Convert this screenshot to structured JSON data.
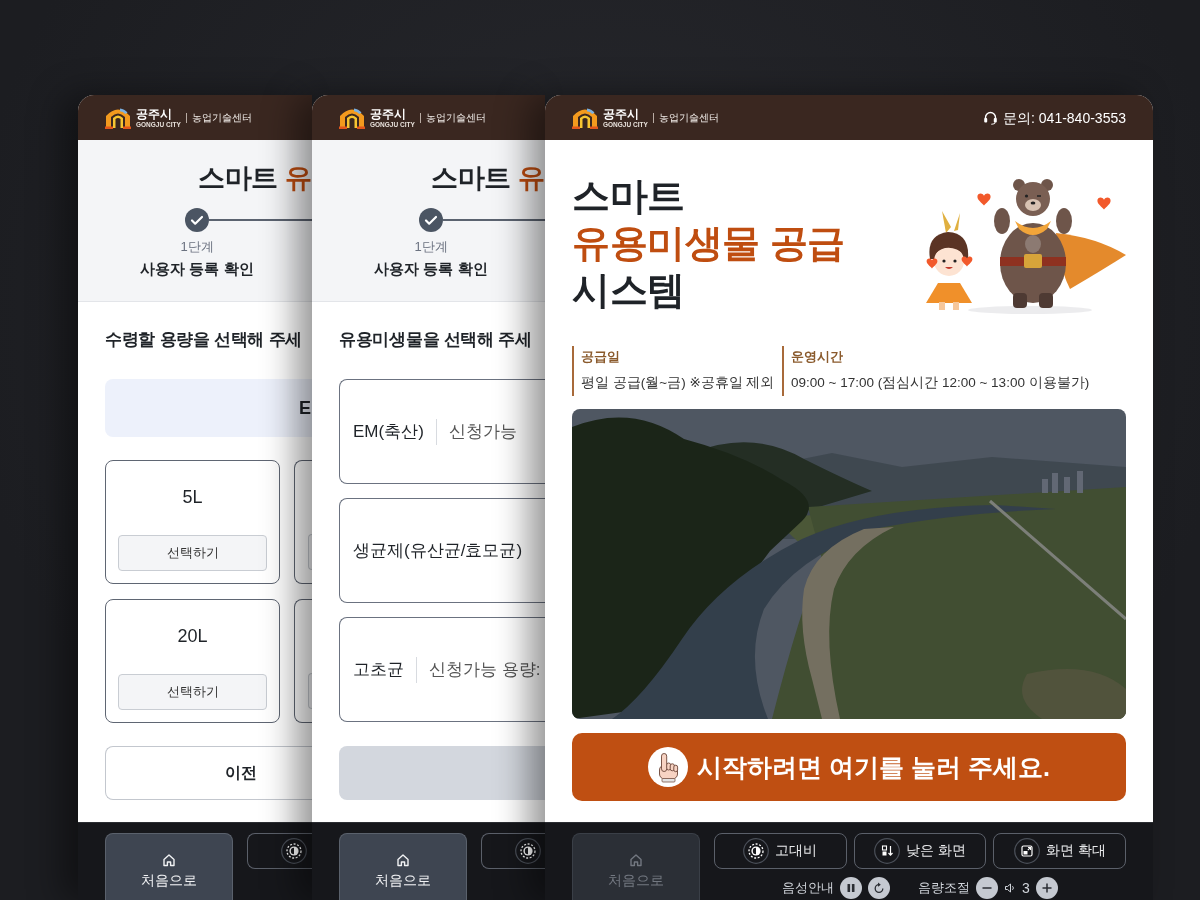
{
  "screens": [
    {
      "kind": "capacity",
      "header": {
        "city": "공주시",
        "city_en": "GONGJU CITY",
        "office": "농업기술센터"
      },
      "title": [
        {
          "text": "스마트",
          "accent": false
        },
        {
          "text": "유",
          "accent": true
        }
      ],
      "steps": [
        {
          "number": "1단계",
          "label": "사용자 등록 확인",
          "done": true
        }
      ],
      "prompt": "수령할 용량을 선택해 주세",
      "selected_item": "E",
      "options": [
        {
          "kind": "full",
          "label": "5L",
          "button": "선택하기"
        },
        {
          "kind": "partial"
        },
        {
          "kind": "full",
          "label": "20L",
          "button": "선택하기"
        },
        {
          "kind": "partial"
        }
      ],
      "back_button": "이전",
      "toolbar": {
        "home": {
          "label": "처음으로",
          "disabled": false
        },
        "buttons": [
          {
            "kind": "contrast"
          }
        ]
      }
    },
    {
      "kind": "microbe",
      "header": {
        "city": "공주시",
        "city_en": "GONGJU CITY",
        "office": "농업기술센터"
      },
      "title": [
        {
          "text": "스마트",
          "accent": false
        },
        {
          "text": "유",
          "accent": true
        }
      ],
      "steps": [
        {
          "number": "1단계",
          "label": "사용자 등록 확인",
          "done": true
        }
      ],
      "prompt": "유용미생물을 선택해 주세",
      "microbes": [
        {
          "name": "EM(축산)",
          "note": "신청가능"
        },
        {
          "name": "생균제(유산균/효모균)"
        },
        {
          "name": "고초균",
          "note": "신청가능 용량:"
        }
      ],
      "action_button": {
        "disabled": true
      },
      "toolbar": {
        "home": {
          "label": "처음으로",
          "disabled": false
        },
        "buttons": [
          {
            "kind": "contrast"
          }
        ]
      }
    },
    {
      "kind": "home",
      "header": {
        "city": "공주시",
        "city_en": "GONGJU CITY",
        "office": "농업기술센터",
        "contact": "문의: 041-840-3553"
      },
      "title": [
        {
          "text": "스마트",
          "accent": false
        },
        {
          "text": "유용미생물 공급",
          "accent": true
        },
        {
          "text": "시스템",
          "accent": false
        }
      ],
      "info": [
        {
          "label": "공급일",
          "value": "평일 공급(월~금) ※공휴일 제외"
        },
        {
          "label": "운영시간",
          "value": "09:00 ~ 17:00 (점심시간 12:00 ~ 13:00 이용불가)"
        }
      ],
      "start_button": "시작하려면 여기를 눌러 주세요.",
      "toolbar": {
        "home": {
          "label": "처음으로",
          "disabled": true
        },
        "buttons": [
          {
            "kind": "contrast",
            "label": "고대비"
          },
          {
            "kind": "low_screen",
            "label": "낮은 화면"
          },
          {
            "kind": "zoom",
            "label": "화면 확대"
          }
        ],
        "audio": {
          "voice_label": "음성안내",
          "volume_label": "음량조절",
          "volume": "3"
        }
      }
    }
  ]
}
